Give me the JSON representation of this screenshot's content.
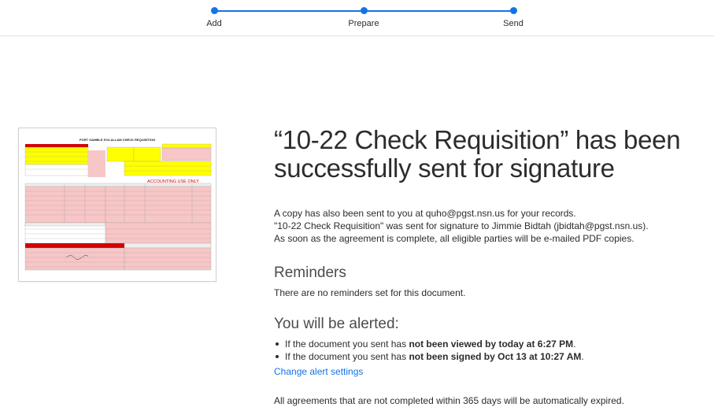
{
  "stepper": {
    "steps": [
      {
        "label": "Add"
      },
      {
        "label": "Prepare"
      },
      {
        "label": "Send"
      }
    ],
    "accent": "#1473e6"
  },
  "thumbnail": {
    "doc_title": "PORT GAMBLE S'KLALLAM CHECK REQUISITION",
    "accounting_label": "ACCOUNTING USE ONLY"
  },
  "main": {
    "title": "“10-22 Check Requisition” has been successfully sent for signature",
    "info_lines": [
      "A copy has also been sent to you at quho@pgst.nsn.us for your records.",
      "\"10-22 Check Requisition\" was sent for signature to Jimmie Bidtah (jbidtah@pgst.nsn.us).",
      "As soon as the agreement is complete, all eligible parties will be e-mailed PDF copies."
    ],
    "reminders": {
      "heading": "Reminders",
      "text": "There are no reminders set for this document."
    },
    "alerts": {
      "heading": "You will be alerted:",
      "items": [
        {
          "prefix": "If the document you sent has ",
          "bold": "not been viewed by today at 6:27 PM",
          "suffix": "."
        },
        {
          "prefix": "If the document you sent has ",
          "bold": "not been signed by Oct 13 at 10:27 AM",
          "suffix": "."
        }
      ],
      "change_link": "Change alert settings"
    },
    "expiry_note": "All agreements that are not completed within 365 days will be automatically expired."
  }
}
